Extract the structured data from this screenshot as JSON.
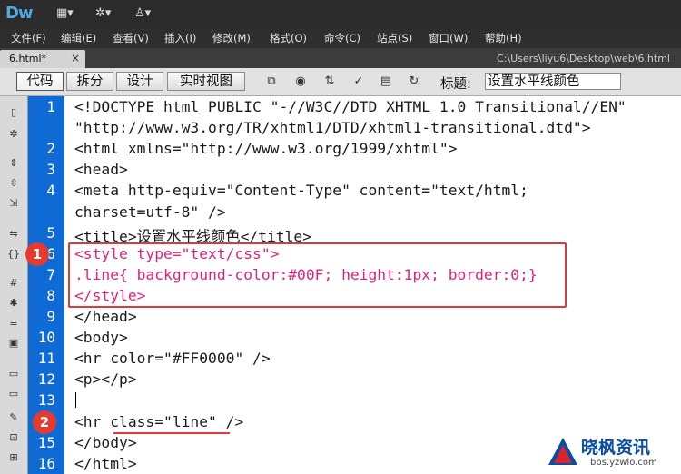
{
  "app": {
    "logo": "Dw"
  },
  "menu": [
    "文件(F)",
    "编辑(E)",
    "查看(V)",
    "插入(I)",
    "修改(M)",
    "格式(O)",
    "命令(C)",
    "站点(S)",
    "窗口(W)",
    "帮助(H)"
  ],
  "tab": {
    "name": "6.html*",
    "close": "×"
  },
  "path": "C:\\Users\\liyu6\\Desktop\\web\\6.html",
  "toolbar": {
    "views": [
      "代码",
      "拆分",
      "设计",
      "实时视图"
    ],
    "title_label": "标题:",
    "title_value": "设置水平线颜色"
  },
  "code": {
    "lines": [
      {
        "num": "1",
        "text": "<!DOCTYPE html PUBLIC \"-//W3C//DTD XHTML 1.0 Transitional//EN\""
      },
      {
        "num": "",
        "text": "\"http://www.w3.org/TR/xhtml1/DTD/xhtml1-transitional.dtd\">"
      },
      {
        "num": "2",
        "text": "<html xmlns=\"http://www.w3.org/1999/xhtml\">"
      },
      {
        "num": "3",
        "text": "<head>"
      },
      {
        "num": "4",
        "text": "<meta http-equiv=\"Content-Type\" content=\"text/html;"
      },
      {
        "num": "",
        "text": "charset=utf-8\" />"
      },
      {
        "num": "5",
        "text": "<title>设置水平线颜色</title>"
      },
      {
        "num": "6",
        "text": "<style type=\"text/css\">"
      },
      {
        "num": "7",
        "text": ".line{ background-color:#00F; height:1px; border:0;}"
      },
      {
        "num": "8",
        "text": "</style>"
      },
      {
        "num": "9",
        "text": "</head>"
      },
      {
        "num": "10",
        "text": "<body>"
      },
      {
        "num": "11",
        "text": "<hr color=\"#FF0000\" />"
      },
      {
        "num": "12",
        "text": "<p></p>"
      },
      {
        "num": "13",
        "text": ""
      },
      {
        "num": "14",
        "text": "<hr class=\"line\" />"
      },
      {
        "num": "15",
        "text": "</body>"
      },
      {
        "num": "16",
        "text": "</html>"
      }
    ]
  },
  "annotations": {
    "badge1": "1",
    "badge2": "2"
  },
  "watermark": {
    "text": "晓枫资讯",
    "url": "bbs.yzwlo.com"
  },
  "colors": {
    "gutter": "#0f6bd3",
    "css_text": "#e0237a",
    "highlight": "#d93a3a"
  }
}
